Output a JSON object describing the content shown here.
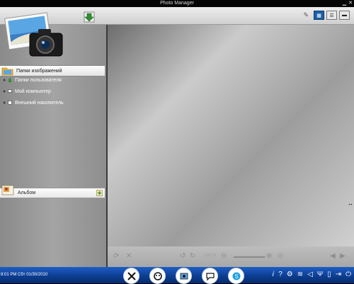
{
  "window": {
    "title": "Photo Manager"
  },
  "sidebar": {
    "items": [
      {
        "label": "Папки изображений"
      },
      {
        "label": "Папки пользователя"
      },
      {
        "label": "Мой компьютер"
      },
      {
        "label": "Внешний накопитель"
      }
    ],
    "album_label": "Альбом"
  },
  "viewer": {
    "zoom_text": "100 %"
  },
  "taskbar": {
    "clock": "8:01 PM Cбт 01/30/2010"
  },
  "colors": {
    "accent": "#1d5fa8",
    "taskbar": "#0d3e92"
  }
}
